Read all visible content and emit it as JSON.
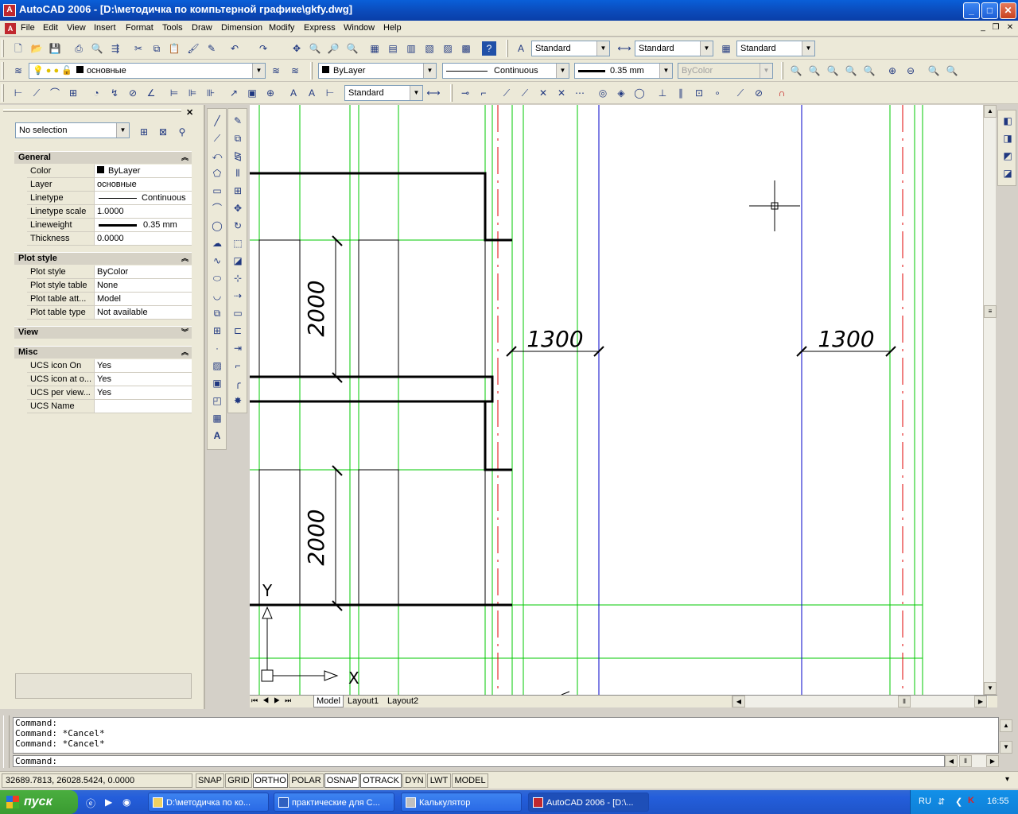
{
  "window": {
    "title": "AutoCAD 2006 - [D:\\методичка по компьтерной графике\\gkfy.dwg]",
    "app_icon": "autocad-icon"
  },
  "menu": {
    "items": [
      "File",
      "Edit",
      "View",
      "Insert",
      "Format",
      "Tools",
      "Draw",
      "Dimension",
      "Modify",
      "Express",
      "Window",
      "Help"
    ]
  },
  "toolbar1": {
    "text_style": "Standard",
    "dim_style": "Standard",
    "table_style": "Standard"
  },
  "toolbar2": {
    "layer": "основные",
    "color": "ByLayer",
    "linetype": "Continuous",
    "lineweight": "0.35 mm",
    "plot_style": "ByColor"
  },
  "toolbar3": {
    "dim_style": "Standard"
  },
  "properties": {
    "selection": "No selection",
    "sections": {
      "general": "General",
      "plot_style": "Plot style",
      "view": "View",
      "misc": "Misc"
    },
    "general": [
      {
        "key": "Color",
        "value": "ByLayer"
      },
      {
        "key": "Layer",
        "value": "основные"
      },
      {
        "key": "Linetype",
        "value": "Continuous"
      },
      {
        "key": "Linetype scale",
        "value": "1.0000"
      },
      {
        "key": "Lineweight",
        "value": "0.35 mm"
      },
      {
        "key": "Thickness",
        "value": "0.0000"
      }
    ],
    "plot_style": [
      {
        "key": "Plot style",
        "value": "ByColor"
      },
      {
        "key": "Plot style table",
        "value": "None"
      },
      {
        "key": "Plot table att...",
        "value": "Model"
      },
      {
        "key": "Plot table type",
        "value": "Not available"
      }
    ],
    "misc": [
      {
        "key": "UCS icon On",
        "value": "Yes"
      },
      {
        "key": "UCS icon at o...",
        "value": "Yes"
      },
      {
        "key": "UCS per view...",
        "value": "Yes"
      },
      {
        "key": "UCS Name",
        "value": ""
      }
    ]
  },
  "drawing": {
    "dimensions": [
      "2000",
      "2000",
      "1300",
      "1300"
    ],
    "ucs_x": "X",
    "ucs_y": "Y"
  },
  "tabs": [
    "Model",
    "Layout1",
    "Layout2"
  ],
  "command_history": [
    "Command:",
    "Command: *Cancel*",
    "Command: *Cancel*"
  ],
  "command_prompt": "Command:",
  "status": {
    "coords": "32689.7813, 26028.5424, 0.0000",
    "buttons": [
      "SNAP",
      "GRID",
      "ORTHO",
      "POLAR",
      "OSNAP",
      "OTRACK",
      "DYN",
      "LWT",
      "MODEL"
    ]
  },
  "taskbar": {
    "start": "пуск",
    "tasks": [
      "D:\\методичка по ко...",
      "практические для С...",
      "Калькулятор",
      "AutoCAD 2006 - [D:\\..."
    ],
    "lang": "RU",
    "clock": "16:55"
  },
  "colors": {
    "title_blue": "#0b49b8",
    "grid_green": "#00c800",
    "axis_red": "#e00000",
    "axis_blue": "#0000c8"
  }
}
